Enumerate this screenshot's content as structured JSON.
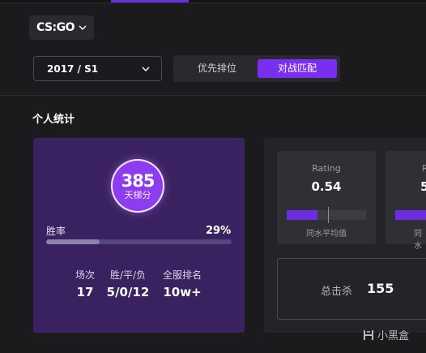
{
  "game_select": {
    "value": "CS:GO"
  },
  "season_select": {
    "value": "2017 / S1"
  },
  "mode_tabs": [
    {
      "label": "优先排位",
      "active": false
    },
    {
      "label": "对战匹配",
      "active": true
    }
  ],
  "section_title": "个人统计",
  "score": {
    "value": "385",
    "label": "天梯分"
  },
  "winrate": {
    "label": "胜率",
    "value": "29%",
    "fraction": 0.29
  },
  "stats": [
    {
      "label": "场次",
      "value": "17"
    },
    {
      "label": "胜/平/负",
      "value": "5/0/12"
    },
    {
      "label": "全服排名",
      "value": "10w+"
    }
  ],
  "rating_cards": [
    {
      "title": "Rating",
      "value": "0.54",
      "avg_label": "同水平均值",
      "fraction": 0.53,
      "avg_fraction": 0.52
    },
    {
      "title": "R",
      "value": "5",
      "avg_label": "同水"
    }
  ],
  "kills": {
    "label": "总击杀",
    "value": "155"
  },
  "watermark": "小黑盒",
  "colors": {
    "accent": "#7a2ff0",
    "card_purple": "#3a2261",
    "background": "#1b1b1e"
  }
}
